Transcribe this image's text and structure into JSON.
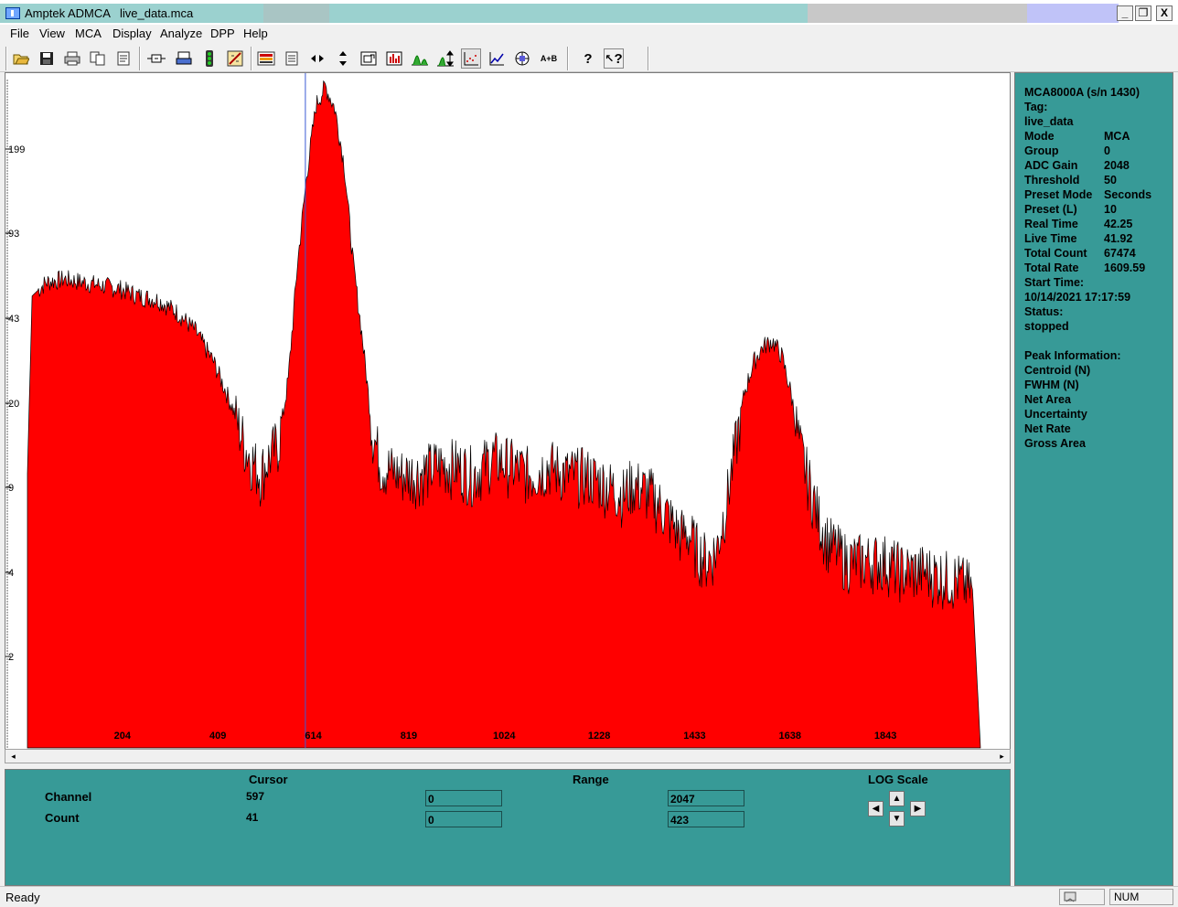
{
  "window": {
    "app_title": "Amptek ADMCA",
    "file_name": "live_data.mca",
    "min_symbol": "_",
    "max_symbol": "❐",
    "close_symbol": "X"
  },
  "menu": {
    "items": [
      "File",
      "View",
      "MCA",
      "Display",
      "Analyze",
      "DPP",
      "Help"
    ]
  },
  "toolbar": {
    "icons": [
      "open-icon",
      "save-icon",
      "print-icon",
      "copy-icon",
      "report-icon",
      "connect-icon",
      "printer-setup-icon",
      "traffic-light-icon",
      "calibrate-icon",
      "colors-icon",
      "document-icon",
      "horizontal-zoom-icon",
      "vertical-zoom-icon",
      "zoom-box-icon",
      "bar-mode-icon",
      "peak-icon",
      "auto-scale-icon",
      "log-scale-icon",
      "line-mode-icon",
      "roi-icon",
      "add-spectra-icon",
      "help-icon",
      "context-help-icon"
    ],
    "add_label": "A+B",
    "help_label": "?",
    "context_help_label": "?"
  },
  "chart_data": {
    "type": "area",
    "title": "",
    "xlabel": "",
    "ylabel": "",
    "y_scale": "log",
    "x_tick_labels": [
      "204",
      "409",
      "614",
      "819",
      "1024",
      "1228",
      "1433",
      "1638",
      "1843"
    ],
    "y_tick_labels": [
      "199",
      "93",
      "43",
      "20",
      "9",
      "4",
      "2"
    ],
    "xlim": [
      0,
      2047
    ],
    "ylim": [
      1,
      423
    ],
    "fill_color": "#ff0000",
    "outline_color": "#000000",
    "cursor_channel": 597,
    "cursor_color": "#3b5bd6",
    "x": [
      0,
      10,
      40,
      80,
      120,
      160,
      200,
      240,
      280,
      320,
      360,
      400,
      440,
      470,
      500,
      520,
      540,
      560,
      580,
      600,
      620,
      640,
      660,
      680,
      700,
      720,
      740,
      760,
      800,
      840,
      880,
      920,
      960,
      1000,
      1040,
      1080,
      1120,
      1160,
      1200,
      1240,
      1280,
      1300,
      1340,
      1380,
      1400,
      1420,
      1440,
      1460,
      1480,
      1500,
      1520,
      1540,
      1560,
      1580,
      1600,
      1620,
      1640,
      1660,
      1680,
      1700,
      1720,
      1740,
      1760,
      1800,
      1840,
      1880,
      1920,
      1960,
      2000,
      2030,
      2047
    ],
    "y": [
      12,
      60,
      68,
      70,
      68,
      66,
      64,
      60,
      58,
      52,
      44,
      33,
      22,
      15,
      12,
      14,
      16,
      28,
      80,
      180,
      340,
      400,
      330,
      200,
      80,
      40,
      18,
      13,
      12,
      12,
      13,
      13,
      12,
      14,
      13,
      12,
      13,
      12,
      12,
      11,
      10,
      11,
      10,
      8,
      7,
      7,
      6,
      5.5,
      6,
      9,
      15,
      25,
      33,
      38,
      40,
      35,
      25,
      15,
      11,
      8,
      6.5,
      6,
      5.5,
      5.5,
      5.5,
      5,
      5,
      4.8,
      4.6,
      4.2,
      1
    ]
  },
  "bottom_panel": {
    "cursor_header": "Cursor",
    "range_header": "Range",
    "log_header": "LOG Scale",
    "channel_label": "Channel",
    "count_label": "Count",
    "cursor_channel": "597",
    "cursor_count": "41",
    "range_channel_low": "0",
    "range_channel_high": "2047",
    "range_count_low": "0",
    "range_count_high": "423"
  },
  "info_panel": {
    "device": "MCA8000A (s/n     1430)",
    "tag_label": "Tag:",
    "tag_value": "live_data",
    "rows": [
      {
        "label": "Mode",
        "value": "MCA"
      },
      {
        "label": "Group",
        "value": "0"
      },
      {
        "label": "ADC Gain",
        "value": "2048"
      },
      {
        "label": "Threshold",
        "value": "50"
      },
      {
        "label": "Preset Mode",
        "value": "Seconds"
      },
      {
        "label": "Preset (L)",
        "value": "10"
      },
      {
        "label": "Real Time",
        "value": "42.25"
      },
      {
        "label": "Live Time",
        "value": "41.92"
      },
      {
        "label": "Total Count",
        "value": "67474"
      },
      {
        "label": "Total Rate",
        "value": "1609.59"
      }
    ],
    "start_time_label": "Start Time:",
    "start_time_value": "10/14/2021 17:17:59",
    "status_label": "Status:",
    "status_value": "stopped",
    "peak_header": "Peak Information:",
    "peak_fields": [
      "Centroid (N)",
      "FWHM (N)",
      "Net Area",
      "Uncertainty",
      "Net Rate",
      "Gross Area"
    ]
  },
  "status_bar": {
    "text": "Ready",
    "num": "NUM"
  }
}
